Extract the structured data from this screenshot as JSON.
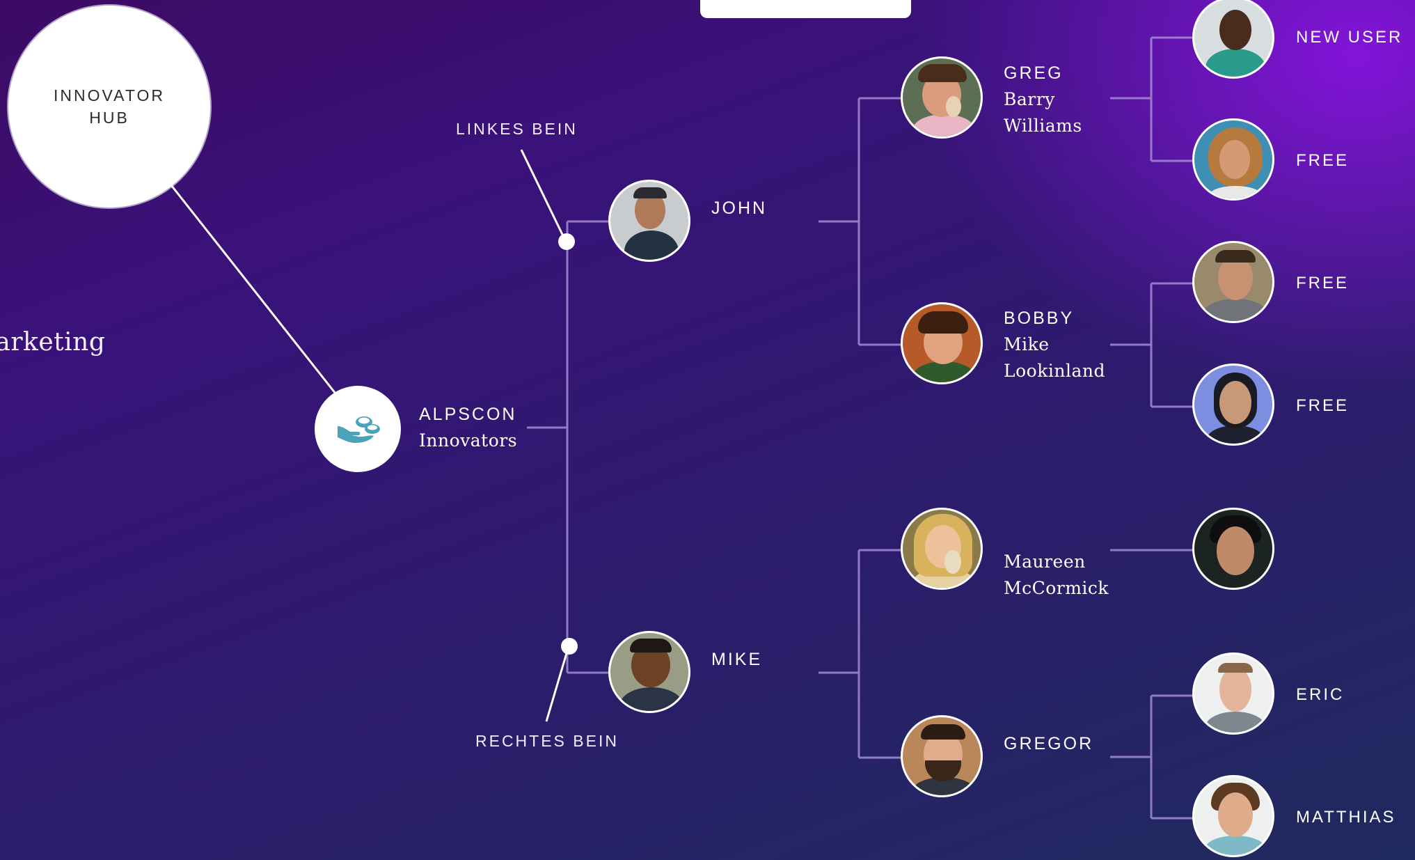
{
  "top_bar": {},
  "hub": {
    "label": "INNOVATOR HUB"
  },
  "side_text": "Marketing",
  "root": {
    "name": "ALPSCON",
    "sub": "Innovators",
    "icon": "hand-coins-icon"
  },
  "legs": {
    "left": "LINKES BEIN",
    "right": "RECHTES BEIN"
  },
  "level1": [
    {
      "name": "JOHN"
    },
    {
      "name": "MIKE"
    }
  ],
  "level2": [
    {
      "name": "GREG",
      "sub1": "Barry",
      "sub2": "Williams"
    },
    {
      "name": "BOBBY",
      "sub1": "Mike",
      "sub2": "Lookinland"
    },
    {
      "name": "",
      "sub1": "Maureen",
      "sub2": "McCormick"
    },
    {
      "name": "GREGOR",
      "sub1": "",
      "sub2": ""
    }
  ],
  "level3": [
    {
      "label": "NEW USER"
    },
    {
      "label": "FREE"
    },
    {
      "label": "FREE"
    },
    {
      "label": "FREE"
    },
    {
      "label": ""
    },
    {
      "label": "ERIC"
    },
    {
      "label": "MATTHIAS"
    }
  ],
  "colors": {
    "background_top": "#3c0a63",
    "background_accent": "#9114eb",
    "background_bottom": "#1f2a5e",
    "connector": "#a58bd6",
    "icon_teal": "#4aa3b8"
  }
}
